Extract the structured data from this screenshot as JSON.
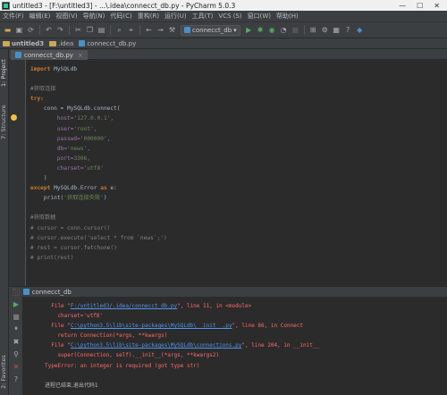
{
  "window": {
    "title": "untitled3 - [F:\\untitled3] - ...\\.idea\\connecct_db.py - PyCharm 5.0.3",
    "min": "—",
    "max": "☐",
    "close": "✕"
  },
  "menu": [
    "文件(F)",
    "编辑(E)",
    "视图(V)",
    "导航(N)",
    "代码(C)",
    "重构(R)",
    "运行(U)",
    "工具(T)",
    "VCS (S)",
    "窗口(W)",
    "帮助(H)"
  ],
  "toolbar": {
    "run_config": "connecct_db",
    "run_config_arrow": "▾"
  },
  "navbar": {
    "project": "untitled3",
    "folder": ".idea",
    "file": "connecct_db.py"
  },
  "sidebar": {
    "project_tab": "1: Project",
    "structure_tab": "7: Structure",
    "favorites_tab": "2: Favorites"
  },
  "editor_tab": {
    "label": "connecct_db.py",
    "close": "×"
  },
  "code": [
    [
      "import ",
      "MySQLdb"
    ],
    [],
    [
      "#获取连接"
    ],
    [
      "try:"
    ],
    [
      "    conn = MySQLdb.connect("
    ],
    [
      "        host='",
      "127.0.0.1",
      "',"
    ],
    [
      "        user='",
      "root",
      "',"
    ],
    [
      "        passwd='",
      "000000",
      "',"
    ],
    [
      "        db='",
      "news",
      "',"
    ],
    [
      "        port=",
      "3306",
      ","
    ],
    [
      "        charset='",
      "utf8",
      "'"
    ],
    [
      "    )"
    ],
    [
      "except ",
      "MySQLdb.Error ",
      "as ",
      "e:"
    ],
    [
      "    print(",
      "'获取连接失败'",
      ")"
    ],
    [],
    [
      "#获取数据"
    ],
    [
      "# cursor = conn.cursor()"
    ],
    [
      "# cursor.execute('select * from `news`;')"
    ],
    [
      "# rest = cursor.fetchone()"
    ],
    [
      "# print(rest)"
    ]
  ],
  "run_panel": {
    "label": "connecct_db",
    "console": [
      {
        "pre": "  File \"",
        "link": "F:/untitled3/.idea/connecct_db.py",
        "post": "\", line 11, in <module>"
      },
      {
        "pre": "    charset='utf8'"
      },
      {
        "pre": "  File \"",
        "link": "C:\\python3.5\\lib\\site-packages\\MySQLdb\\__init__.py",
        "post": "\", line 86, in Connect"
      },
      {
        "pre": "    return Connection(*args, **kwargs)"
      },
      {
        "pre": "  File \"",
        "link": "C:\\python3.5\\lib\\site-packages\\MySQLdb\\connections.py",
        "post": "\", line 204, in __init__"
      },
      {
        "pre": "    super(Connection, self).__init__(*args, **kwargs2)"
      },
      {
        "pre": "TypeError: an integer is required (got type str)"
      }
    ],
    "exit": "进程已结束,退出代码1"
  }
}
